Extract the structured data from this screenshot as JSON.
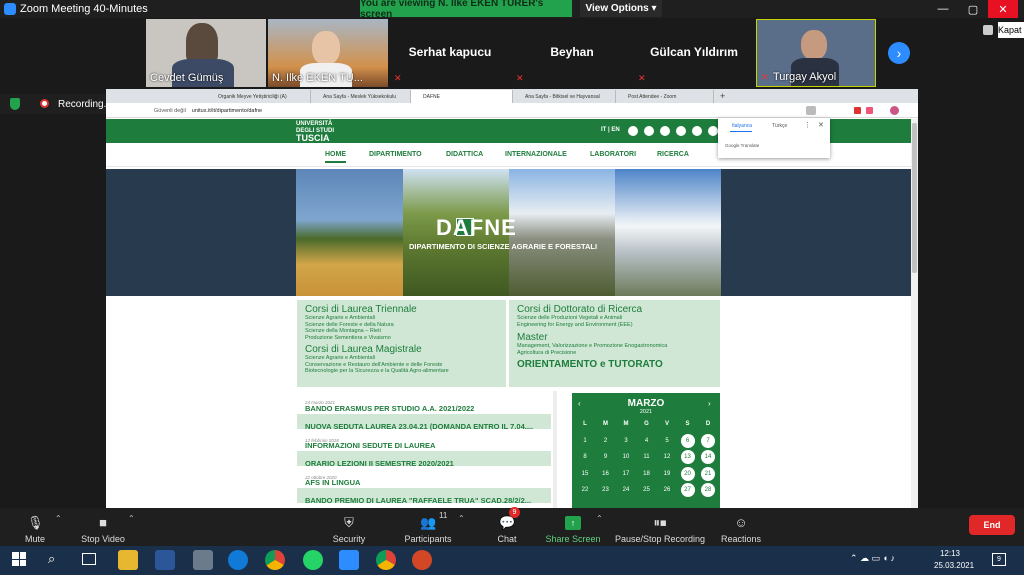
{
  "zoom": {
    "window_title": "Zoom Meeting 40-Minutes",
    "banner": "You are viewing N. Ilke EKEN TURER's screen",
    "view_options": "View Options",
    "tooltip_close": "Kapat",
    "recording": "Recording..."
  },
  "participants": [
    {
      "name": "Cevdet Gümüş",
      "video": true,
      "color": "#c9c6c1"
    },
    {
      "name": "N. Ilke EKEN TU...",
      "video": true,
      "color": "#c47a3c"
    },
    {
      "name": "Serhat  kapucu",
      "video": false
    },
    {
      "name": "Beyhan",
      "video": false
    },
    {
      "name": "Gülcan Yıldırım",
      "video": false
    },
    {
      "name": "Turgay Akyol",
      "video": true,
      "color": "#5a6e8a"
    }
  ],
  "browser": {
    "tabs": [
      {
        "label": "Organik Meyve Yetiştiriciliği (A)"
      },
      {
        "label": "Ana Sayfa - Meslek Yüksekokulu"
      },
      {
        "label": "DAFNE",
        "active": true
      },
      {
        "label": "Ana Sayfa - Bitkisel ve Hayvansal"
      },
      {
        "label": "Post Attendee - Zoom"
      }
    ],
    "security": "Güvenli değil",
    "url": "unitus.it/it/dipartimento/dafne"
  },
  "site": {
    "logo_line1": "UNIVERSITÀ",
    "logo_line2": "DEGLI STUDI",
    "logo_line3": "TUSCIA",
    "lang_it": "IT",
    "lang_en": "EN",
    "nav": [
      "HOME",
      "DIPARTIMENTO",
      "DIDATTICA",
      "INTERNAZIONALE",
      "LABORATORI",
      "RICERCA"
    ],
    "hero_title": "DAFNE",
    "hero_subtitle": "DIPARTIMENTO DI SCIENZE AGRARIE E FORESTALI",
    "translate": {
      "lang1": "Italyanca",
      "lang2": "Türkçe",
      "brand": "Google Translate"
    }
  },
  "courses": {
    "triennale_title": "Corsi di Laurea Triennale",
    "triennale_items": [
      "Scienze Agrarie e Ambientali",
      "Scienze delle Foreste e della Natura",
      "Scienze della Montagna – Rieti",
      "Produzione Sementiera e Vivaismo"
    ],
    "magistrale_title": "Corsi di Laurea Magistrale",
    "magistrale_items": [
      "Scienze Agrarie e Ambientali",
      "Conservazione e Restauro dell'Ambiente e delle Foreste",
      "Biotecnologie per la Sicurezza e la Qualità Agro-alimentare"
    ],
    "dottorato_title": "Corsi di Dottorato di Ricerca",
    "dottorato_items": [
      "Scienze delle Produzioni Vegetali e Animali",
      "Engineering for Energy and Environment (EEE)"
    ],
    "master_title": "Master",
    "master_items": [
      "Management, Valorizzazione e Promozione Enogastronomica",
      "Agricoltura di Precisione"
    ],
    "orientamento": "ORIENTAMENTO e TUTORATO"
  },
  "news": [
    {
      "date": "24 marzo 2021",
      "title": "BANDO ERASMUS PER STUDIO A.A. 2021/2022"
    },
    {
      "date": "16 marzo 2021",
      "title": "NUOVA SEDUTA LAUREA 23.04.21 (DOMANDA ENTRO IL 7.04...."
    },
    {
      "date": "12 febbraio 2018",
      "title": "INFORMAZIONI SEDUTE DI LAUREA"
    },
    {
      "date": "17 settembre 2020",
      "title": "ORARIO LEZIONI II SEMESTRE 2020/2021"
    },
    {
      "date": "22 ottobre 2020",
      "title": "AFS IN LINGUA"
    },
    {
      "date": "15 dicembre 2020",
      "title": "BANDO PREMIO DI LAUREA \"RAFFAELE TRUA\" SCAD.28/2/2..."
    }
  ],
  "calendar": {
    "month": "MARZO",
    "year": "2021",
    "weekdays": [
      "L",
      "M",
      "M",
      "G",
      "V",
      "S",
      "D"
    ],
    "rows": [
      [
        "1",
        "2",
        "3",
        "4",
        "5",
        "6",
        "7"
      ],
      [
        "8",
        "9",
        "10",
        "11",
        "12",
        "13",
        "14"
      ],
      [
        "15",
        "16",
        "17",
        "18",
        "19",
        "20",
        "21"
      ],
      [
        "22",
        "23",
        "24",
        "25",
        "26",
        "27",
        "28"
      ]
    ]
  },
  "toolbar": {
    "mute": "Mute",
    "stop_video": "Stop Video",
    "security": "Security",
    "participants": "Participants",
    "participants_count": "11",
    "chat": "Chat",
    "chat_badge": "9",
    "share_screen": "Share Screen",
    "pause_recording": "Pause/Stop Recording",
    "reactions": "Reactions",
    "end": "End"
  },
  "taskbar": {
    "time": "12:13",
    "date": "25.03.2021",
    "notification_count": "9"
  },
  "colors": {
    "accent": "#1e7d3c",
    "zoom_blue": "#2d8cff",
    "end_red": "#e02828",
    "banner_green": "#23a24d"
  }
}
